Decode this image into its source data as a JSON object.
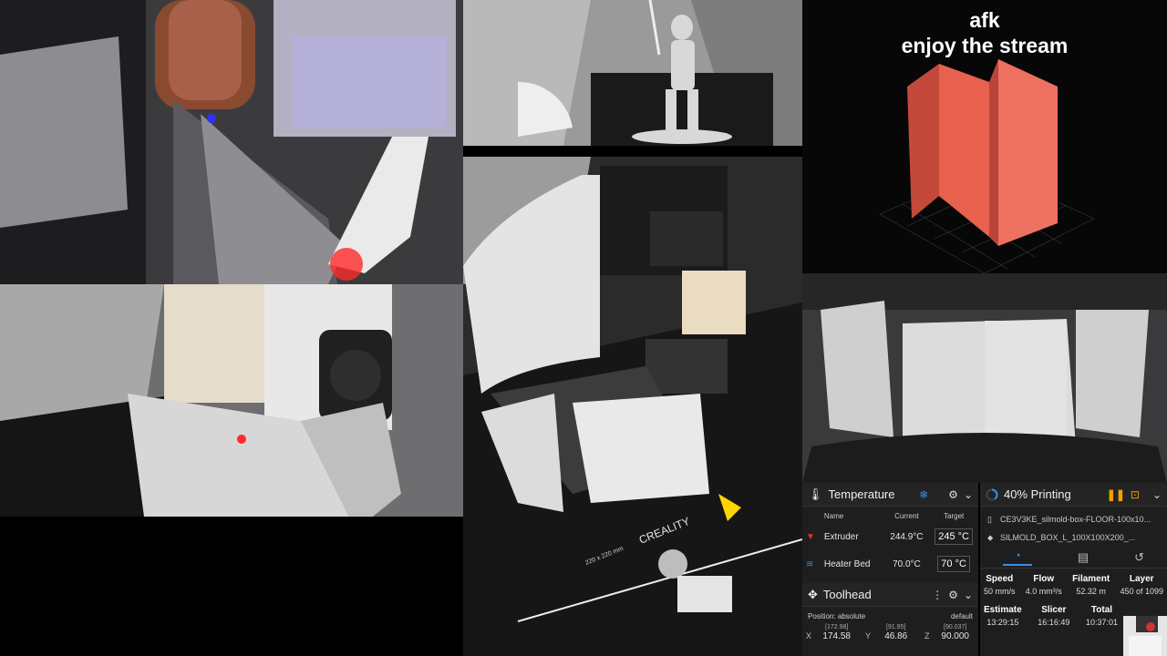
{
  "overlay": {
    "line1": "afk",
    "line2": "enjoy the stream"
  },
  "temperature": {
    "title": "Temperature",
    "headers": {
      "name": "Name",
      "current": "Current",
      "target": "Target"
    },
    "rows": [
      {
        "name": "Extruder",
        "current": "244.9°C",
        "target": "245",
        "unit": "°C"
      },
      {
        "name": "Heater Bed",
        "current": "70.0°C",
        "target": "70",
        "unit": "°C"
      }
    ]
  },
  "toolhead": {
    "title": "Toolhead",
    "position_mode": "Position: absolute",
    "mode_label": "default",
    "x": {
      "label": "X",
      "value": "174.58",
      "sub": "[172.98]"
    },
    "y": {
      "label": "Y",
      "value": "46.86",
      "sub": "[91.95]"
    },
    "z": {
      "label": "Z",
      "value": "90.000",
      "sub": "[90.037]"
    }
  },
  "status": {
    "title": "40% Printing",
    "progress": 0.4,
    "file1": "CE3V3KE_silmold-box-FLOOR-100x10...",
    "file2": "SILMOLD_BOX_L_100X100X200_...",
    "stats": [
      {
        "label": "Speed",
        "value": "50 mm/s"
      },
      {
        "label": "Flow",
        "value": "4.0 mm³/s"
      },
      {
        "label": "Filament",
        "value": "52.32 m"
      },
      {
        "label": "Layer",
        "value": "450 of 1099"
      }
    ],
    "times": [
      {
        "label": "Estimate",
        "value": "13:29:15"
      },
      {
        "label": "Slicer",
        "value": "16:16:49"
      },
      {
        "label": "Total",
        "value": "10:37:01"
      }
    ]
  },
  "bed_label": "CREALITY",
  "bed_size_label": "220 x 220 mm",
  "colors": {
    "accent": "#3a8ee6",
    "model": "#e8614e",
    "panel": "#1e1e1e",
    "pause": "#f0a000"
  }
}
